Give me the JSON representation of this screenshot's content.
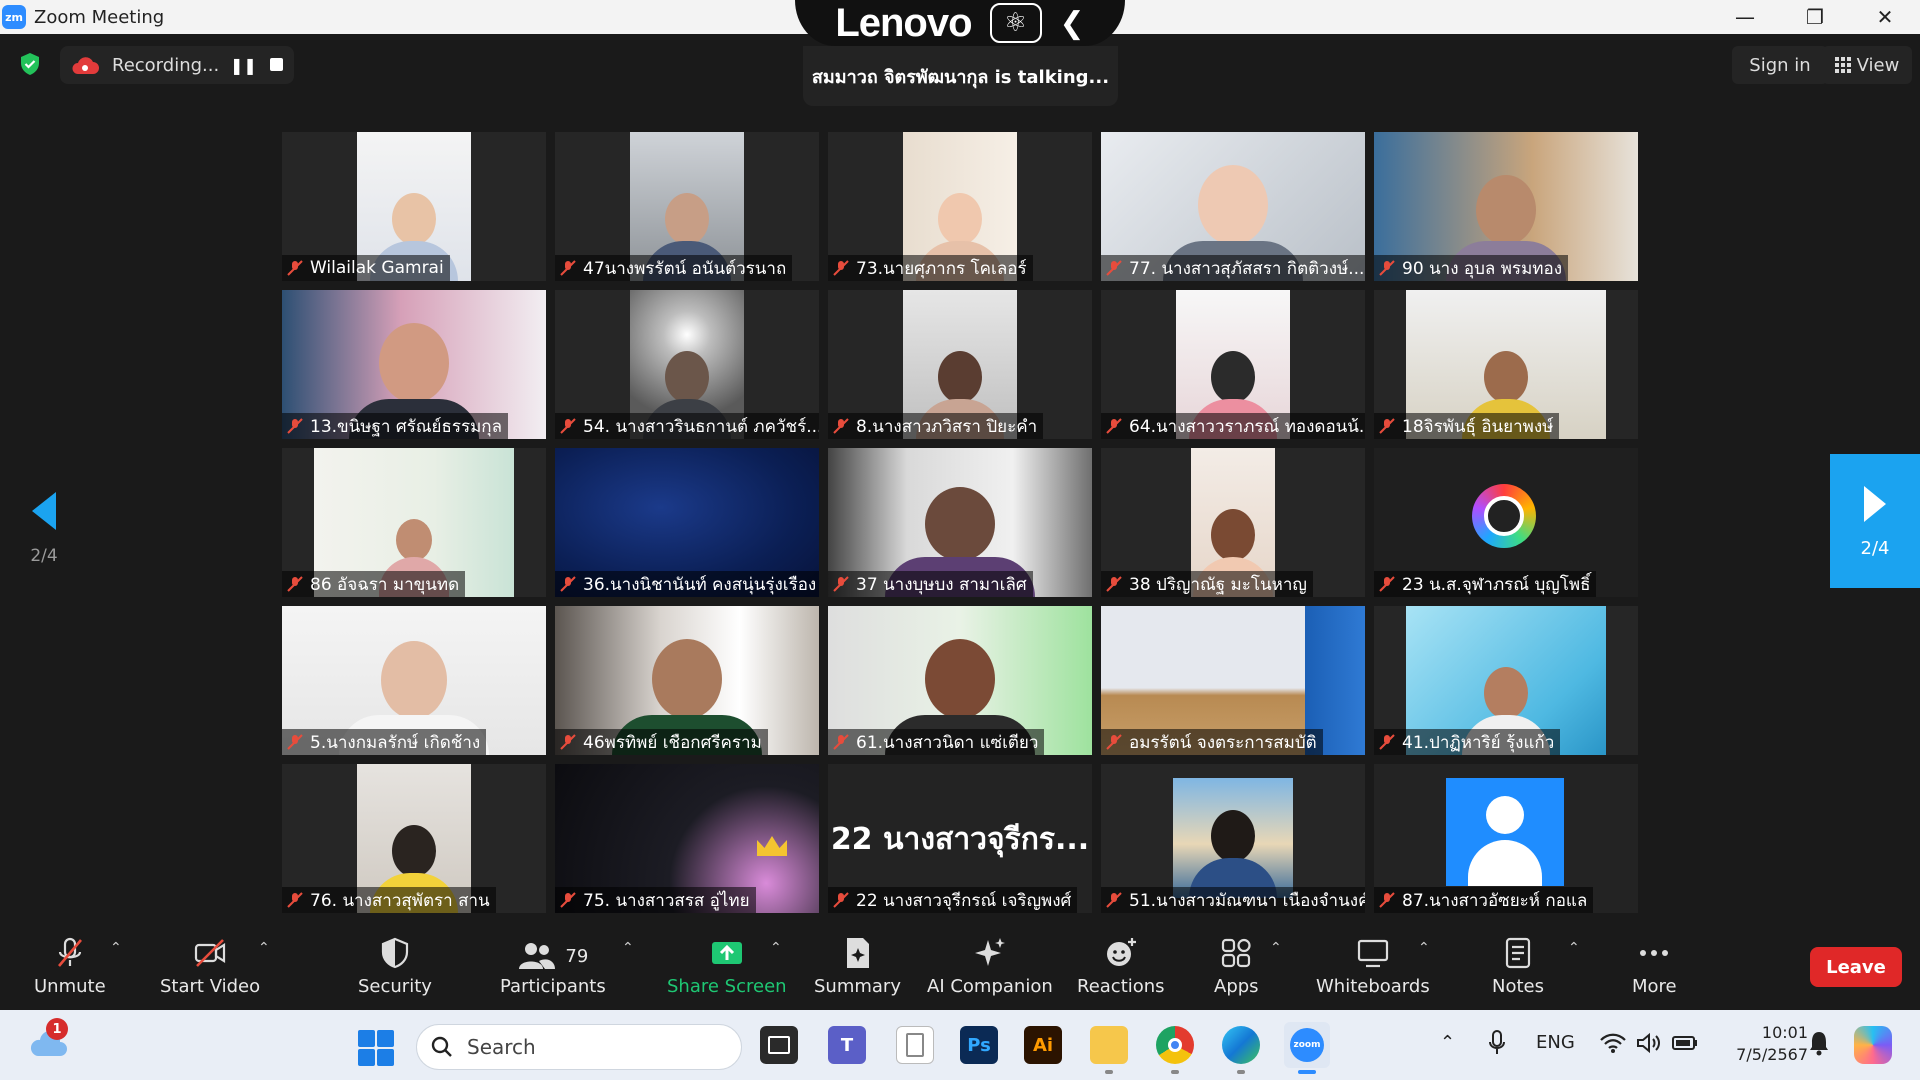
{
  "window": {
    "title": "Zoom Meeting",
    "app_icon_text": "zm"
  },
  "overlay": {
    "brand": "Lenovo",
    "talking": "สมมาวถ จิตรพัฒนากุล is talking..."
  },
  "topbar": {
    "recording_label": "Recording...",
    "sign_in": "Sign in",
    "view": "View"
  },
  "pagination": {
    "left": "2/4",
    "right": "2/4"
  },
  "tiles": [
    {
      "name": "Wilailak Gamrai",
      "kind": "video"
    },
    {
      "name": "47นางพรรัตน์ อนันต์วรนาถ",
      "kind": "video"
    },
    {
      "name": "73.นายศุภากร โคเลอร์",
      "kind": "video"
    },
    {
      "name": "77. นางสาวสุภัสสรา กิตติวงษ์...",
      "kind": "video"
    },
    {
      "name": "90 นาง อุบล  พรมทอง",
      "kind": "video"
    },
    {
      "name": "13.ขนิษฐา  ศรัณย์ธรรมกุล",
      "kind": "video"
    },
    {
      "name": "54. นางสาวรินธกานต์ ภควัชร์...",
      "kind": "video"
    },
    {
      "name": "8.นางสาวภวิสรา ปิยะคำ",
      "kind": "video"
    },
    {
      "name": "64.นางสาววราภรณ์ ทองดอนน้...",
      "kind": "video"
    },
    {
      "name": "18จิรพันธุ์ อินยาพงษ์",
      "kind": "video"
    },
    {
      "name": "86 อัจฉรา มาขุนทด",
      "kind": "video"
    },
    {
      "name": "36.นางนิชานันท์ คงสนุ่นรุ่งเรือง",
      "kind": "video"
    },
    {
      "name": "37 นางบุษบง  สามาเลิศ",
      "kind": "video"
    },
    {
      "name": "38 ปริญาณัฐ  มะโนหาญ",
      "kind": "video"
    },
    {
      "name": "23 น.ส.จุฬาภรณ์  บุญโพธิ์",
      "kind": "lens"
    },
    {
      "name": "5.นางกมลรักษ์ เกิดช้าง",
      "kind": "video"
    },
    {
      "name": "46พรทิพย์  เชือกศรีคราม",
      "kind": "video"
    },
    {
      "name": "61.นางสาวนิดา แซ่เตียว",
      "kind": "video"
    },
    {
      "name": "อมรรัตน์ จงตระการสมบัติ",
      "kind": "video"
    },
    {
      "name": "41.ปาฏิหาริย์  รุ้งแก้ว",
      "kind": "video"
    },
    {
      "name": "76. นางสาวสุพัตรา สาน",
      "kind": "video"
    },
    {
      "name": "75. นางสาวสรส อู่ไทย",
      "kind": "video"
    },
    {
      "name": "22 นางสาวจุรีกรณ์ เจริญพงศ์",
      "kind": "text",
      "big": "22 นางสาวจุรีกร..."
    },
    {
      "name": "51.นางสาวมัณฑนา เนืองจำนงค์",
      "kind": "video"
    },
    {
      "name": "87.นางสาวอัซยะห์  กอแล",
      "kind": "avatar"
    }
  ],
  "toolbar": {
    "unmute": "Unmute",
    "start_video": "Start Video",
    "security": "Security",
    "participants": "Participants",
    "participants_count": "79",
    "share_screen": "Share Screen",
    "summary": "Summary",
    "ai_companion": "AI Companion",
    "reactions": "Reactions",
    "apps": "Apps",
    "whiteboards": "Whiteboards",
    "notes": "Notes",
    "more": "More",
    "leave": "Leave"
  },
  "taskbar": {
    "notification_count": "1",
    "search_placeholder": "Search",
    "lang": "ENG",
    "time": "10:01",
    "date": "7/5/2567",
    "ps_label": "Ps",
    "ai_label": "Ai",
    "zoom_label": "zoom"
  },
  "colors": {
    "accent": "#2d8cff",
    "share_green": "#1ec773",
    "leave_red": "#e02828",
    "nav_blue": "#1ba3f0"
  }
}
